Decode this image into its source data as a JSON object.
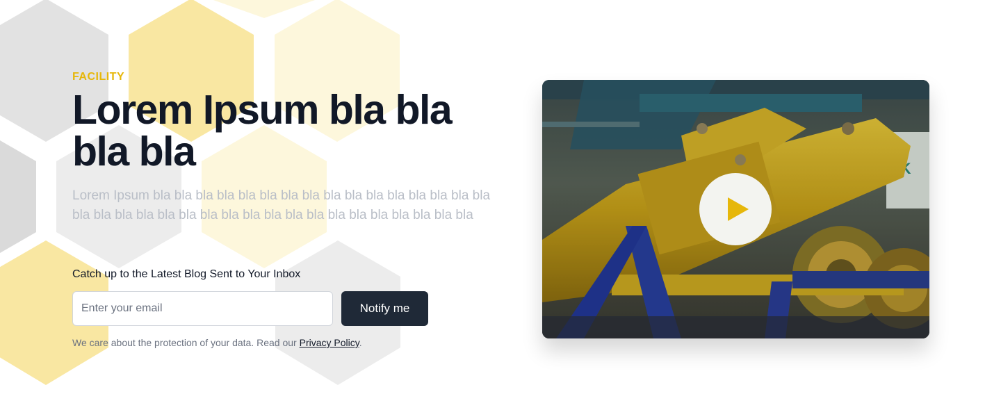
{
  "hero": {
    "eyebrow": "FACILITY",
    "title_line1": "Lorem Ipsum bla bla",
    "title_line2": "bla bla",
    "subtitle": "Lorem Ipsum bla bla bla bla bla bla bla bla bla bla bla bla bla bla bla bla bla bla bla bla bla bla bla bla bla bla bla bla bla bla bla bla bla bla bla"
  },
  "signup": {
    "label": "Catch up to the Latest Blog Sent to Your Inbox",
    "email_placeholder": "Enter your email",
    "email_value": "",
    "button_label": "Notify me",
    "privacy_prefix": "We care about the protection of your data. Read our",
    "privacy_link": "Privacy Policy",
    "privacy_suffix": "."
  },
  "video": {
    "play_icon": "play-icon"
  },
  "colors": {
    "accent": "#e6b70a",
    "heading": "#111827",
    "button": "#1f2937",
    "muted": "#b9bec7"
  }
}
